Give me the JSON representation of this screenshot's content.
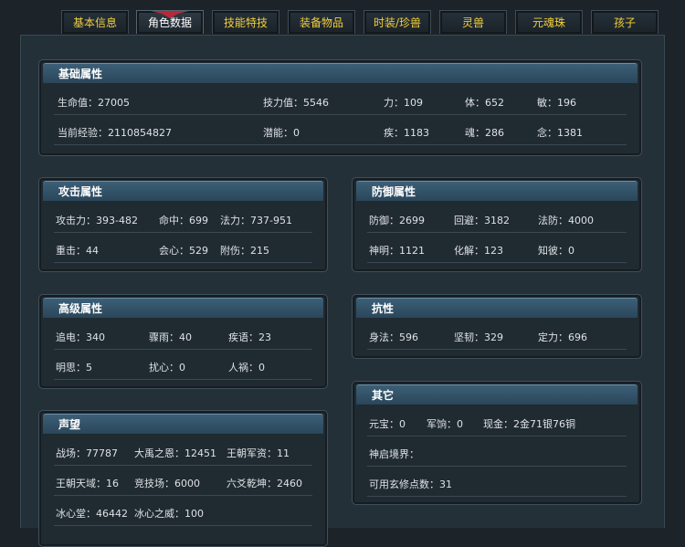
{
  "tabs": [
    {
      "label": "基本信息"
    },
    {
      "label": "角色数据"
    },
    {
      "label": "技能特技"
    },
    {
      "label": "装备物品"
    },
    {
      "label": "时装/珍兽"
    },
    {
      "label": "灵兽"
    },
    {
      "label": "元魂珠"
    },
    {
      "label": "孩子"
    }
  ],
  "active_tab": "角色数据",
  "panels": {
    "basic": {
      "title": "基础属性",
      "rows": [
        [
          "生命值：27005",
          "技力值：5546",
          "力：109",
          "体：652",
          "敏：196"
        ],
        [
          "当前经验：2110854827",
          "潜能：0",
          "疾：1183",
          "魂：286",
          "念：1381"
        ]
      ]
    },
    "attack": {
      "title": "攻击属性",
      "rows": [
        [
          "攻击力：393-482",
          "命中：699",
          "法力：737-951"
        ],
        [
          "重击：44",
          "会心：529",
          "附伤：215"
        ]
      ]
    },
    "defense": {
      "title": "防御属性",
      "rows": [
        [
          "防御：2699",
          "回避：3182",
          "法防：4000"
        ],
        [
          "神明：1121",
          "化解：123",
          "知彼：0"
        ]
      ]
    },
    "advanced": {
      "title": "高级属性",
      "rows": [
        [
          "追电：340",
          "骤雨：40",
          "疾语：23"
        ],
        [
          "明思：5",
          "扰心：0",
          "人祸：0"
        ]
      ]
    },
    "resist": {
      "title": "抗性",
      "rows": [
        [
          "身法：596",
          "坚韧：329",
          "定力：696"
        ]
      ]
    },
    "other": {
      "title": "其它",
      "rows": [
        [
          "元宝：0",
          "军饷：0",
          "现金：2金71银76铜"
        ],
        [
          "神启境界："
        ],
        [
          "可用玄修点数：31"
        ]
      ]
    },
    "fame": {
      "title": "声望",
      "rows": [
        [
          "战场：77787",
          "大禹之恩：12451",
          "王朝军资：11"
        ],
        [
          "王朝天域：16",
          "竞技场：6000",
          "六爻乾坤：2460"
        ],
        [
          "冰心堂：46442",
          "冰心之威：100"
        ]
      ]
    }
  }
}
